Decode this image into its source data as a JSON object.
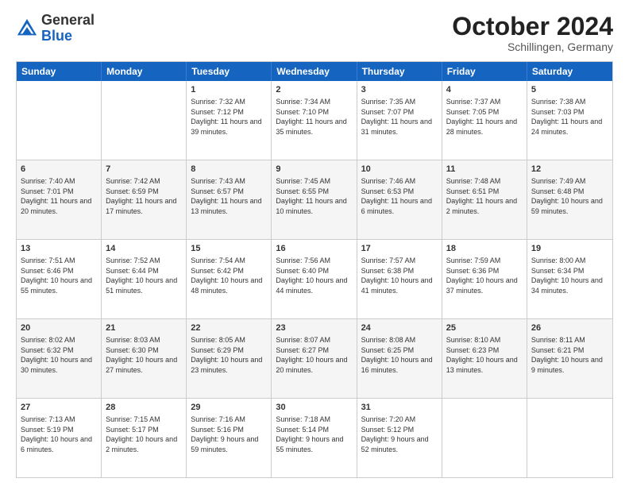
{
  "header": {
    "logo_general": "General",
    "logo_blue": "Blue",
    "month_title": "October 2024",
    "location": "Schillingen, Germany"
  },
  "days_of_week": [
    "Sunday",
    "Monday",
    "Tuesday",
    "Wednesday",
    "Thursday",
    "Friday",
    "Saturday"
  ],
  "weeks": [
    [
      {
        "day": "",
        "empty": true
      },
      {
        "day": "",
        "empty": true
      },
      {
        "day": "1",
        "sunrise": "Sunrise: 7:32 AM",
        "sunset": "Sunset: 7:12 PM",
        "daylight": "Daylight: 11 hours and 39 minutes."
      },
      {
        "day": "2",
        "sunrise": "Sunrise: 7:34 AM",
        "sunset": "Sunset: 7:10 PM",
        "daylight": "Daylight: 11 hours and 35 minutes."
      },
      {
        "day": "3",
        "sunrise": "Sunrise: 7:35 AM",
        "sunset": "Sunset: 7:07 PM",
        "daylight": "Daylight: 11 hours and 31 minutes."
      },
      {
        "day": "4",
        "sunrise": "Sunrise: 7:37 AM",
        "sunset": "Sunset: 7:05 PM",
        "daylight": "Daylight: 11 hours and 28 minutes."
      },
      {
        "day": "5",
        "sunrise": "Sunrise: 7:38 AM",
        "sunset": "Sunset: 7:03 PM",
        "daylight": "Daylight: 11 hours and 24 minutes."
      }
    ],
    [
      {
        "day": "6",
        "sunrise": "Sunrise: 7:40 AM",
        "sunset": "Sunset: 7:01 PM",
        "daylight": "Daylight: 11 hours and 20 minutes."
      },
      {
        "day": "7",
        "sunrise": "Sunrise: 7:42 AM",
        "sunset": "Sunset: 6:59 PM",
        "daylight": "Daylight: 11 hours and 17 minutes."
      },
      {
        "day": "8",
        "sunrise": "Sunrise: 7:43 AM",
        "sunset": "Sunset: 6:57 PM",
        "daylight": "Daylight: 11 hours and 13 minutes."
      },
      {
        "day": "9",
        "sunrise": "Sunrise: 7:45 AM",
        "sunset": "Sunset: 6:55 PM",
        "daylight": "Daylight: 11 hours and 10 minutes."
      },
      {
        "day": "10",
        "sunrise": "Sunrise: 7:46 AM",
        "sunset": "Sunset: 6:53 PM",
        "daylight": "Daylight: 11 hours and 6 minutes."
      },
      {
        "day": "11",
        "sunrise": "Sunrise: 7:48 AM",
        "sunset": "Sunset: 6:51 PM",
        "daylight": "Daylight: 11 hours and 2 minutes."
      },
      {
        "day": "12",
        "sunrise": "Sunrise: 7:49 AM",
        "sunset": "Sunset: 6:48 PM",
        "daylight": "Daylight: 10 hours and 59 minutes."
      }
    ],
    [
      {
        "day": "13",
        "sunrise": "Sunrise: 7:51 AM",
        "sunset": "Sunset: 6:46 PM",
        "daylight": "Daylight: 10 hours and 55 minutes."
      },
      {
        "day": "14",
        "sunrise": "Sunrise: 7:52 AM",
        "sunset": "Sunset: 6:44 PM",
        "daylight": "Daylight: 10 hours and 51 minutes."
      },
      {
        "day": "15",
        "sunrise": "Sunrise: 7:54 AM",
        "sunset": "Sunset: 6:42 PM",
        "daylight": "Daylight: 10 hours and 48 minutes."
      },
      {
        "day": "16",
        "sunrise": "Sunrise: 7:56 AM",
        "sunset": "Sunset: 6:40 PM",
        "daylight": "Daylight: 10 hours and 44 minutes."
      },
      {
        "day": "17",
        "sunrise": "Sunrise: 7:57 AM",
        "sunset": "Sunset: 6:38 PM",
        "daylight": "Daylight: 10 hours and 41 minutes."
      },
      {
        "day": "18",
        "sunrise": "Sunrise: 7:59 AM",
        "sunset": "Sunset: 6:36 PM",
        "daylight": "Daylight: 10 hours and 37 minutes."
      },
      {
        "day": "19",
        "sunrise": "Sunrise: 8:00 AM",
        "sunset": "Sunset: 6:34 PM",
        "daylight": "Daylight: 10 hours and 34 minutes."
      }
    ],
    [
      {
        "day": "20",
        "sunrise": "Sunrise: 8:02 AM",
        "sunset": "Sunset: 6:32 PM",
        "daylight": "Daylight: 10 hours and 30 minutes."
      },
      {
        "day": "21",
        "sunrise": "Sunrise: 8:03 AM",
        "sunset": "Sunset: 6:30 PM",
        "daylight": "Daylight: 10 hours and 27 minutes."
      },
      {
        "day": "22",
        "sunrise": "Sunrise: 8:05 AM",
        "sunset": "Sunset: 6:29 PM",
        "daylight": "Daylight: 10 hours and 23 minutes."
      },
      {
        "day": "23",
        "sunrise": "Sunrise: 8:07 AM",
        "sunset": "Sunset: 6:27 PM",
        "daylight": "Daylight: 10 hours and 20 minutes."
      },
      {
        "day": "24",
        "sunrise": "Sunrise: 8:08 AM",
        "sunset": "Sunset: 6:25 PM",
        "daylight": "Daylight: 10 hours and 16 minutes."
      },
      {
        "day": "25",
        "sunrise": "Sunrise: 8:10 AM",
        "sunset": "Sunset: 6:23 PM",
        "daylight": "Daylight: 10 hours and 13 minutes."
      },
      {
        "day": "26",
        "sunrise": "Sunrise: 8:11 AM",
        "sunset": "Sunset: 6:21 PM",
        "daylight": "Daylight: 10 hours and 9 minutes."
      }
    ],
    [
      {
        "day": "27",
        "sunrise": "Sunrise: 7:13 AM",
        "sunset": "Sunset: 5:19 PM",
        "daylight": "Daylight: 10 hours and 6 minutes."
      },
      {
        "day": "28",
        "sunrise": "Sunrise: 7:15 AM",
        "sunset": "Sunset: 5:17 PM",
        "daylight": "Daylight: 10 hours and 2 minutes."
      },
      {
        "day": "29",
        "sunrise": "Sunrise: 7:16 AM",
        "sunset": "Sunset: 5:16 PM",
        "daylight": "Daylight: 9 hours and 59 minutes."
      },
      {
        "day": "30",
        "sunrise": "Sunrise: 7:18 AM",
        "sunset": "Sunset: 5:14 PM",
        "daylight": "Daylight: 9 hours and 55 minutes."
      },
      {
        "day": "31",
        "sunrise": "Sunrise: 7:20 AM",
        "sunset": "Sunset: 5:12 PM",
        "daylight": "Daylight: 9 hours and 52 minutes."
      },
      {
        "day": "",
        "empty": true
      },
      {
        "day": "",
        "empty": true
      }
    ]
  ]
}
